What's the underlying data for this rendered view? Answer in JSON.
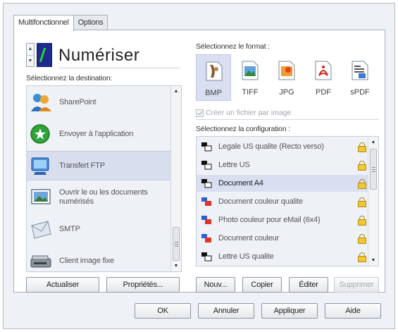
{
  "tabs": [
    {
      "label": "Multifonctionnel",
      "active": true
    },
    {
      "label": "Options",
      "active": false
    }
  ],
  "header": {
    "title": "Numériser",
    "spinner_up": "▲",
    "spinner_down": "▼"
  },
  "destination": {
    "label": "Sélectionnez la destination:",
    "items": [
      {
        "label": "SharePoint",
        "icon": "sharepoint-icon"
      },
      {
        "label": "Envoyer à l'application",
        "icon": "send-to-application-icon"
      },
      {
        "label": "Transfert FTP",
        "icon": "ftp-transfer-icon",
        "selected": true
      },
      {
        "label": "Ouvrir le ou les documents numérisés",
        "icon": "open-documents-icon"
      },
      {
        "label": "SMTP",
        "icon": "smtp-email-icon"
      },
      {
        "label": "Client image fixe",
        "icon": "still-image-client-icon"
      }
    ],
    "scroll_up": "▲",
    "scroll_down": "▼"
  },
  "format": {
    "label": "Sélectionnez le format :",
    "items": [
      {
        "label": "BMP",
        "icon": "bmp-format-icon",
        "selected": true
      },
      {
        "label": "TIFF",
        "icon": "tiff-format-icon"
      },
      {
        "label": "JPG",
        "icon": "jpg-format-icon"
      },
      {
        "label": "PDF",
        "icon": "pdf-format-icon"
      },
      {
        "label": "sPDF",
        "icon": "spdf-format-icon"
      }
    ],
    "checkbox_label": "Créer un fichier par image"
  },
  "configuration": {
    "label": "Sélectionnez la configuration :",
    "items": [
      {
        "label": "Legale US qualite (Recto verso)",
        "icon": "bw-document-icon"
      },
      {
        "label": "Lettre US",
        "icon": "bw-document-icon"
      },
      {
        "label": "Document A4",
        "icon": "bw-document-icon",
        "selected": true
      },
      {
        "label": "Document couleur qualite",
        "icon": "color-document-icon"
      },
      {
        "label": "Photo couleur pour eMail (6x4)",
        "icon": "color-document-icon"
      },
      {
        "label": "Document couleur",
        "icon": "color-document-icon"
      },
      {
        "label": "Lettre US qualite",
        "icon": "bw-document-icon"
      }
    ],
    "scroll_up": "▲",
    "scroll_down": "▼"
  },
  "left_buttons": {
    "refresh": "Actualiser",
    "properties": "Propriétés..."
  },
  "right_buttons": {
    "new": "Nouv...",
    "copy": "Copier",
    "edit": "Éditer",
    "delete": "Supprimer"
  },
  "dialog_buttons": {
    "ok": "OK",
    "cancel": "Annuler",
    "apply": "Appliquer",
    "help": "Aide"
  },
  "colors": {
    "selection": "#d9def0",
    "list_bg": "#eef1f6",
    "badge_blue": "#1d2b8f",
    "badge_green": "#35d12a"
  }
}
